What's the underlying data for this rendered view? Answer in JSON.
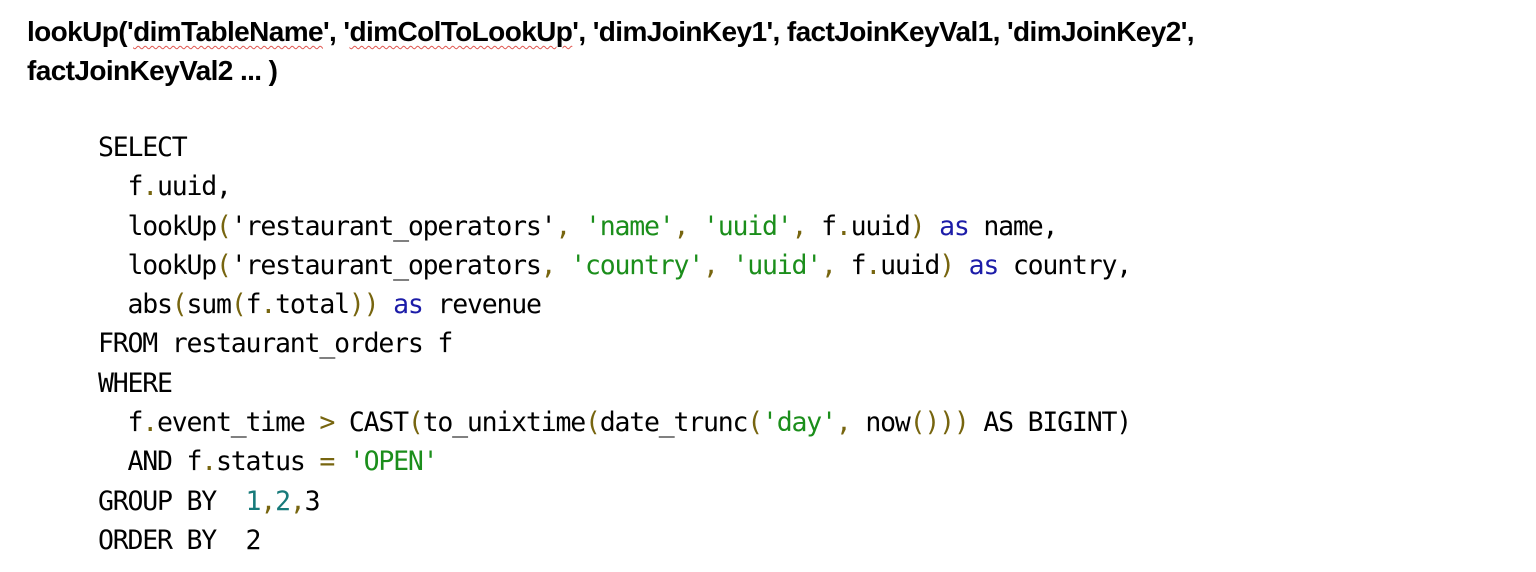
{
  "heading": {
    "line1": [
      {
        "text": "lookUp('",
        "squiggle": false
      },
      {
        "text": "dimTableName",
        "squiggle": true
      },
      {
        "text": "', '",
        "squiggle": false
      },
      {
        "text": "dimColToLookUp",
        "squiggle": true
      },
      {
        "text": "', 'dimJoinKey1', factJoinKeyVal1, 'dimJoinKey2',",
        "squiggle": false
      }
    ],
    "line2": "factJoinKeyVal2 ... )"
  },
  "colors": {
    "plain": "#000000",
    "punct": "#77650f",
    "string": "#1b8e1b",
    "keyword": "#1c1ca8",
    "number": "#177a7a",
    "spellcheck_underline": "#e0564f"
  },
  "code": {
    "language": "sql",
    "lines": [
      [
        {
          "t": "plain",
          "v": "SELECT"
        }
      ],
      [
        {
          "t": "plain",
          "v": "  f"
        },
        {
          "t": "punct",
          "v": "."
        },
        {
          "t": "plain",
          "v": "uuid,"
        }
      ],
      [
        {
          "t": "plain",
          "v": "  lookUp"
        },
        {
          "t": "punct",
          "v": "("
        },
        {
          "t": "plain",
          "v": "'restaurant_operators'"
        },
        {
          "t": "punct",
          "v": ","
        },
        {
          "t": "plain",
          "v": " "
        },
        {
          "t": "string",
          "v": "'name'"
        },
        {
          "t": "punct",
          "v": ","
        },
        {
          "t": "plain",
          "v": " "
        },
        {
          "t": "string",
          "v": "'uuid'"
        },
        {
          "t": "punct",
          "v": ","
        },
        {
          "t": "plain",
          "v": " f"
        },
        {
          "t": "punct",
          "v": "."
        },
        {
          "t": "plain",
          "v": "uuid"
        },
        {
          "t": "punct",
          "v": ")"
        },
        {
          "t": "plain",
          "v": " "
        },
        {
          "t": "keyword",
          "v": "as"
        },
        {
          "t": "plain",
          "v": " name,"
        }
      ],
      [
        {
          "t": "plain",
          "v": "  lookUp"
        },
        {
          "t": "punct",
          "v": "("
        },
        {
          "t": "plain",
          "v": "'restaurant_operators"
        },
        {
          "t": "punct",
          "v": ","
        },
        {
          "t": "plain",
          "v": " "
        },
        {
          "t": "string",
          "v": "'country'"
        },
        {
          "t": "punct",
          "v": ","
        },
        {
          "t": "plain",
          "v": " "
        },
        {
          "t": "string",
          "v": "'uuid'"
        },
        {
          "t": "punct",
          "v": ","
        },
        {
          "t": "plain",
          "v": " f"
        },
        {
          "t": "punct",
          "v": "."
        },
        {
          "t": "plain",
          "v": "uuid"
        },
        {
          "t": "punct",
          "v": ")"
        },
        {
          "t": "plain",
          "v": " "
        },
        {
          "t": "keyword",
          "v": "as"
        },
        {
          "t": "plain",
          "v": " country,"
        }
      ],
      [
        {
          "t": "plain",
          "v": "  abs"
        },
        {
          "t": "punct",
          "v": "("
        },
        {
          "t": "plain",
          "v": "sum"
        },
        {
          "t": "punct",
          "v": "("
        },
        {
          "t": "plain",
          "v": "f"
        },
        {
          "t": "punct",
          "v": "."
        },
        {
          "t": "plain",
          "v": "total"
        },
        {
          "t": "punct",
          "v": "))"
        },
        {
          "t": "plain",
          "v": " "
        },
        {
          "t": "keyword",
          "v": "as"
        },
        {
          "t": "plain",
          "v": " revenue"
        }
      ],
      [
        {
          "t": "plain",
          "v": "FROM restaurant_orders f"
        }
      ],
      [
        {
          "t": "plain",
          "v": "WHERE"
        }
      ],
      [
        {
          "t": "plain",
          "v": "  f"
        },
        {
          "t": "punct",
          "v": "."
        },
        {
          "t": "plain",
          "v": "event_time "
        },
        {
          "t": "punct",
          "v": ">"
        },
        {
          "t": "plain",
          "v": " CAST"
        },
        {
          "t": "punct",
          "v": "("
        },
        {
          "t": "plain",
          "v": "to_unixtime"
        },
        {
          "t": "punct",
          "v": "("
        },
        {
          "t": "plain",
          "v": "date_trunc"
        },
        {
          "t": "punct",
          "v": "("
        },
        {
          "t": "string",
          "v": "'day'"
        },
        {
          "t": "punct",
          "v": ","
        },
        {
          "t": "plain",
          "v": " now"
        },
        {
          "t": "punct",
          "v": "()))"
        },
        {
          "t": "plain",
          "v": " AS BIGINT)"
        }
      ],
      [
        {
          "t": "plain",
          "v": "  AND f"
        },
        {
          "t": "punct",
          "v": "."
        },
        {
          "t": "plain",
          "v": "status "
        },
        {
          "t": "punct",
          "v": "="
        },
        {
          "t": "plain",
          "v": " "
        },
        {
          "t": "string",
          "v": "'OPEN'"
        }
      ],
      [
        {
          "t": "plain",
          "v": "GROUP BY  "
        },
        {
          "t": "number",
          "v": "1"
        },
        {
          "t": "punct",
          "v": ","
        },
        {
          "t": "number",
          "v": "2"
        },
        {
          "t": "punct",
          "v": ","
        },
        {
          "t": "plain",
          "v": "3"
        }
      ],
      [
        {
          "t": "plain",
          "v": "ORDER BY  2"
        }
      ]
    ]
  }
}
